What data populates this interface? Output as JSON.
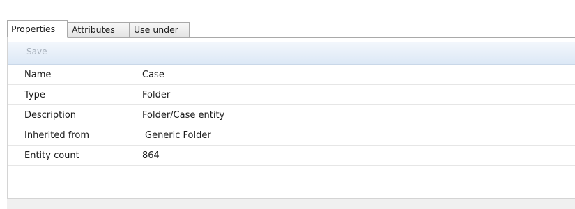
{
  "tabs": [
    {
      "label": "Properties",
      "active": true
    },
    {
      "label": "Attributes",
      "active": false
    },
    {
      "label": "Use under",
      "active": false
    }
  ],
  "toolbar": {
    "save_label": "Save",
    "save_enabled": false
  },
  "properties": [
    {
      "label": "Name",
      "value": "Case"
    },
    {
      "label": "Type",
      "value": "Folder"
    },
    {
      "label": "Description",
      "value": "Folder/Case entity"
    },
    {
      "label": "Inherited from",
      "value": "Generic Folder"
    },
    {
      "label": "Entity count",
      "value": "864"
    }
  ],
  "colors": {
    "toolbar_gradient_top": "#f3f7fc",
    "toolbar_gradient_bottom": "#dce8f6",
    "disabled_text": "#a7b0bb"
  }
}
